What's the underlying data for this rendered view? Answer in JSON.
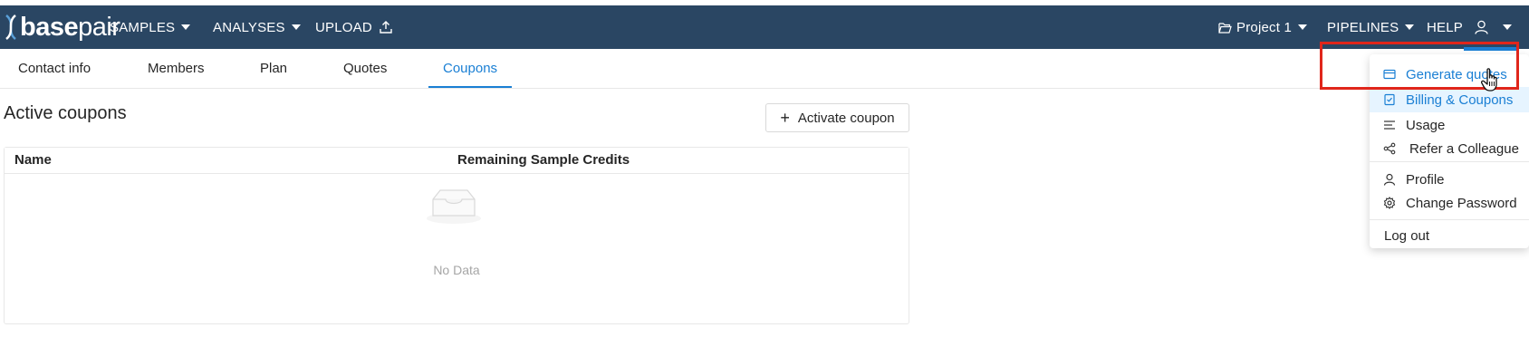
{
  "brand": {
    "logo_text_bold": "base",
    "logo_text_light": "pair"
  },
  "nav": {
    "samples": "SAMPLES",
    "analyses": "ANALYSES",
    "upload": "UPLOAD",
    "project": "Project 1",
    "pipelines": "PIPELINES",
    "help": "HELP"
  },
  "tabs": [
    {
      "label": "Contact info"
    },
    {
      "label": "Members"
    },
    {
      "label": "Plan"
    },
    {
      "label": "Quotes"
    },
    {
      "label": "Coupons"
    }
  ],
  "active_tab": "Coupons",
  "main": {
    "title": "Active coupons",
    "activate_button": "Activate coupon",
    "table": {
      "columns": [
        "Name",
        "Remaining Sample Credits"
      ],
      "rows": [],
      "empty_text": "No Data"
    }
  },
  "user_menu": {
    "items": [
      {
        "label": "Generate quotes",
        "icon": "card-icon",
        "state": "hover"
      },
      {
        "label": "Billing & Coupons",
        "icon": "billing-icon",
        "state": "selected"
      },
      {
        "label": "Usage",
        "icon": "usage-icon"
      },
      {
        "label": "Refer a Colleague",
        "icon": "share-icon"
      },
      {
        "label": "Profile",
        "icon": "user-icon"
      },
      {
        "label": "Change Password",
        "icon": "gear-icon"
      },
      {
        "label": "Log out",
        "icon": ""
      }
    ]
  },
  "colors": {
    "header_bg": "#2a4663",
    "accent": "#1a7fd4",
    "highlight_box": "#e0261b"
  }
}
